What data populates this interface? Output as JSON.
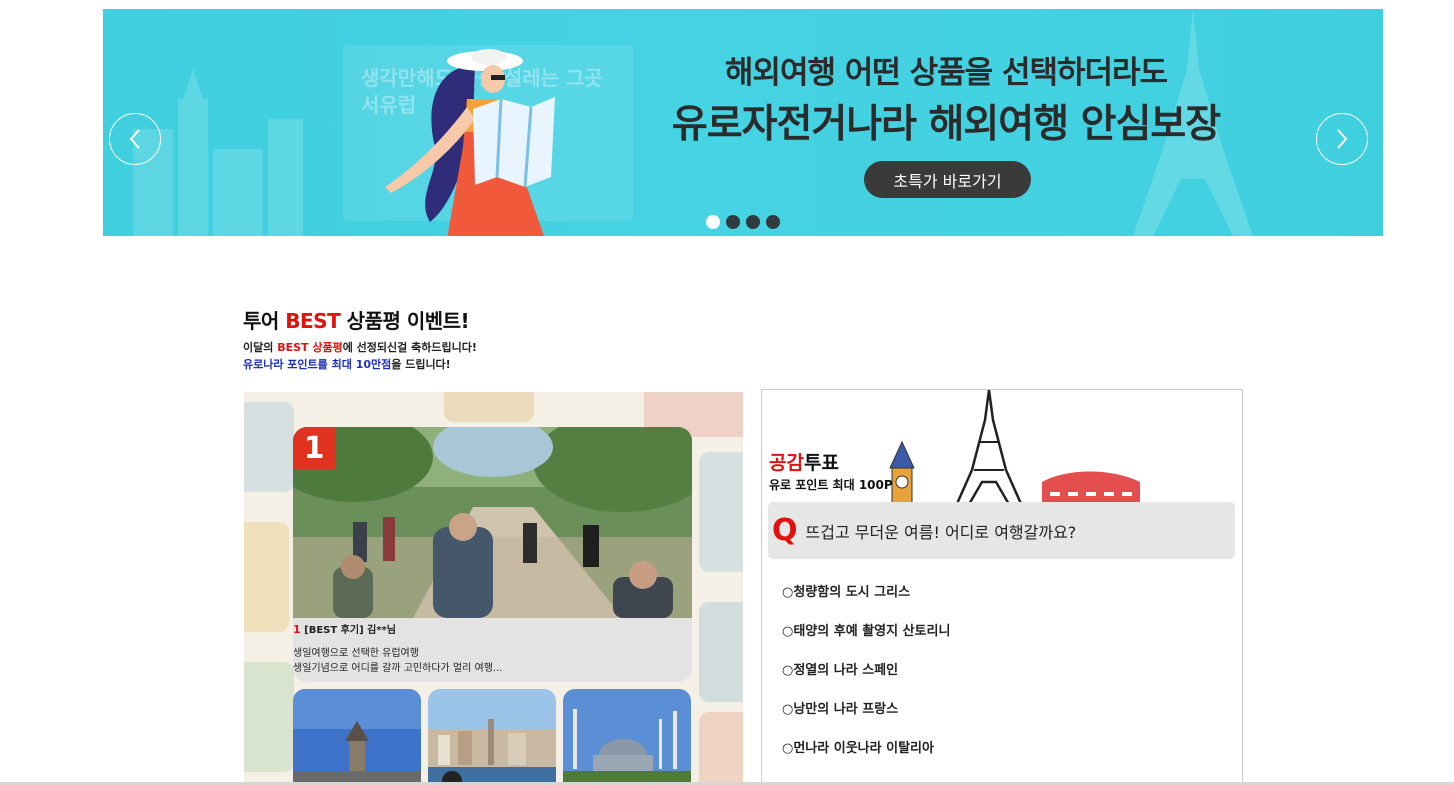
{
  "banner": {
    "faint_text_line1": "생각만해도 가슴 설레는 그곳",
    "faint_text_line2": "서유럽",
    "headline_line1": "해외여행 어떤 상품을 선택하더라도",
    "headline_line2": "유로자전거나라 해외여행 안심보장",
    "cta_label": "초특가 바로가기",
    "prev_icon": "chevron-left-icon",
    "next_icon": "chevron-right-icon",
    "slides_total": 4,
    "active_slide": 1,
    "background_color": "#46d3e3"
  },
  "event": {
    "title_prefix": "투어 ",
    "title_highlight": "BEST",
    "title_suffix": " 상품평 이벤트!",
    "sub1_prefix": "이달의 ",
    "sub1_highlight": "BEST 상품평",
    "sub1_suffix": "에 선정되신걸 축하드립니다!",
    "sub2_highlight": "유로나라 포인트를 최대 10만점",
    "sub2_suffix": "을 드립니다!"
  },
  "review": {
    "rank_badge": "1",
    "rank_num": "1",
    "meta": " [BEST 후기] 김**님",
    "body_line1": "생일여행으로 선택한 유럽여행",
    "body_line2": "생일기념으로 어디를 갈까 고민하다가 멀리 여행...",
    "thumbnails": [
      "galata-tower-thumb",
      "istanbul-waterfront-thumb",
      "blue-mosque-thumb"
    ]
  },
  "vote": {
    "title_highlight": "공감",
    "title_suffix": "투표",
    "subtitle": "유로 포인트 최대 100P",
    "q_mark": "Q",
    "question": "뜨겁고 무더운 여름! 어디로 여행갈까요?",
    "options": [
      "○청량함의 도시 그리스",
      "○태양의 후예 촬영지 산토리니",
      "○정열의 나라 스페인",
      "○낭만의 나라 프랑스",
      "○먼나라 이웃나라 이탈리아"
    ],
    "accent_color": "#e0120f"
  }
}
